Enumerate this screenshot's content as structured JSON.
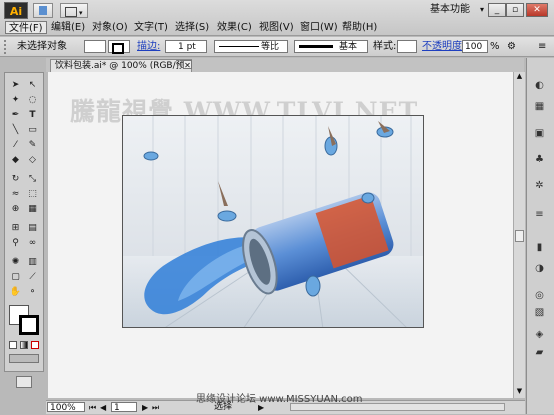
{
  "app": {
    "logo_text": "Ai"
  },
  "menu": [
    "文件(F)",
    "编辑(E)",
    "对象(O)",
    "文字(T)",
    "选择(S)",
    "效果(C)",
    "视图(V)",
    "窗口(W)",
    "帮助(H)"
  ],
  "workspace_label": "基本功能",
  "control_bar": {
    "selection_label": "未选择对象",
    "stroke_label": "描边:",
    "stroke_value": "1 pt",
    "profile_label": "等比",
    "brush_label": "基本",
    "style_label": "样式:",
    "opacity_label": "不透明度:",
    "opacity_value": "100",
    "percent": "%"
  },
  "document_tab": {
    "title": "饮料包装.ai* @ 100% (RGB/预览)"
  },
  "watermark": "騰龍視覺 WWW.TLVI.NET",
  "status_bar": {
    "zoom": "100%",
    "page": "1",
    "status_text": "选择"
  },
  "footer_watermark": "思缘设计论坛  www.MISSYUAN.com",
  "colors": {
    "accent": "#1e3fbf",
    "chrome": "#cfcfcf",
    "can_blue": "#5b8fd6"
  },
  "icons": [
    "selection-tool-icon",
    "direct-selection-tool-icon",
    "pen-tool-icon",
    "type-tool-icon",
    "line-tool-icon",
    "rectangle-tool-icon",
    "brush-tool-icon",
    "pencil-tool-icon",
    "rotate-tool-icon",
    "scale-tool-icon",
    "hand-tool-icon",
    "zoom-tool-icon"
  ]
}
